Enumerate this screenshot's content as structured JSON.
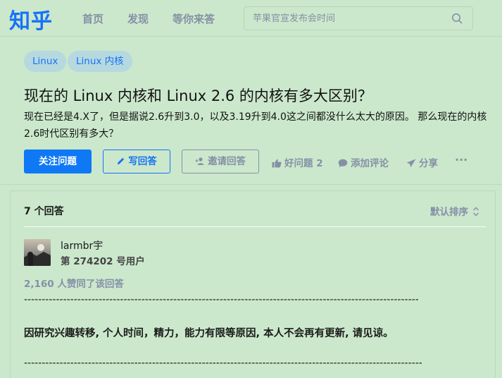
{
  "header": {
    "logo": "知乎",
    "nav": [
      "首页",
      "发现",
      "等你来答"
    ],
    "search_placeholder": "苹果官宣发布会时间"
  },
  "question": {
    "tags": [
      "Linux",
      "Linux 内核"
    ],
    "title": "现在的 Linux 内核和 Linux 2.6 的内核有多大区别？",
    "description": "现在已经是4.X了，但是据说2.6升到3.0，以及3.19升到4.0这之间都没什么太大的原因。 那么现在的内核2.6时代区别有多大？",
    "follow_label": "关注问题",
    "write_label": "写回答",
    "invite_label": "邀请回答",
    "good_label": "好问题 2",
    "comment_label": "添加评论",
    "share_label": "分享",
    "more_label": "···"
  },
  "answers": {
    "count_label": "7 个回答",
    "sort_label": "默认排序",
    "first": {
      "author": "larmbr宇",
      "headline": "第 274202 号用户",
      "votes": "2,160 人赞同了该回答",
      "dash_line_1": "----------------------------------------------------------------------------------------------------------------------------",
      "text": "因研究兴趣转移, 个人时间，精力，能力有限等原因, 本人不会再有更新, 请见谅。",
      "dash_line_2": "----------------------------------------------------------------------------------------------------------------------------"
    }
  },
  "colors": {
    "background": "#cbe8cc",
    "brand_blue": "#1772f6",
    "muted": "#8590a6",
    "tag_bg": "#b6d9e0"
  }
}
